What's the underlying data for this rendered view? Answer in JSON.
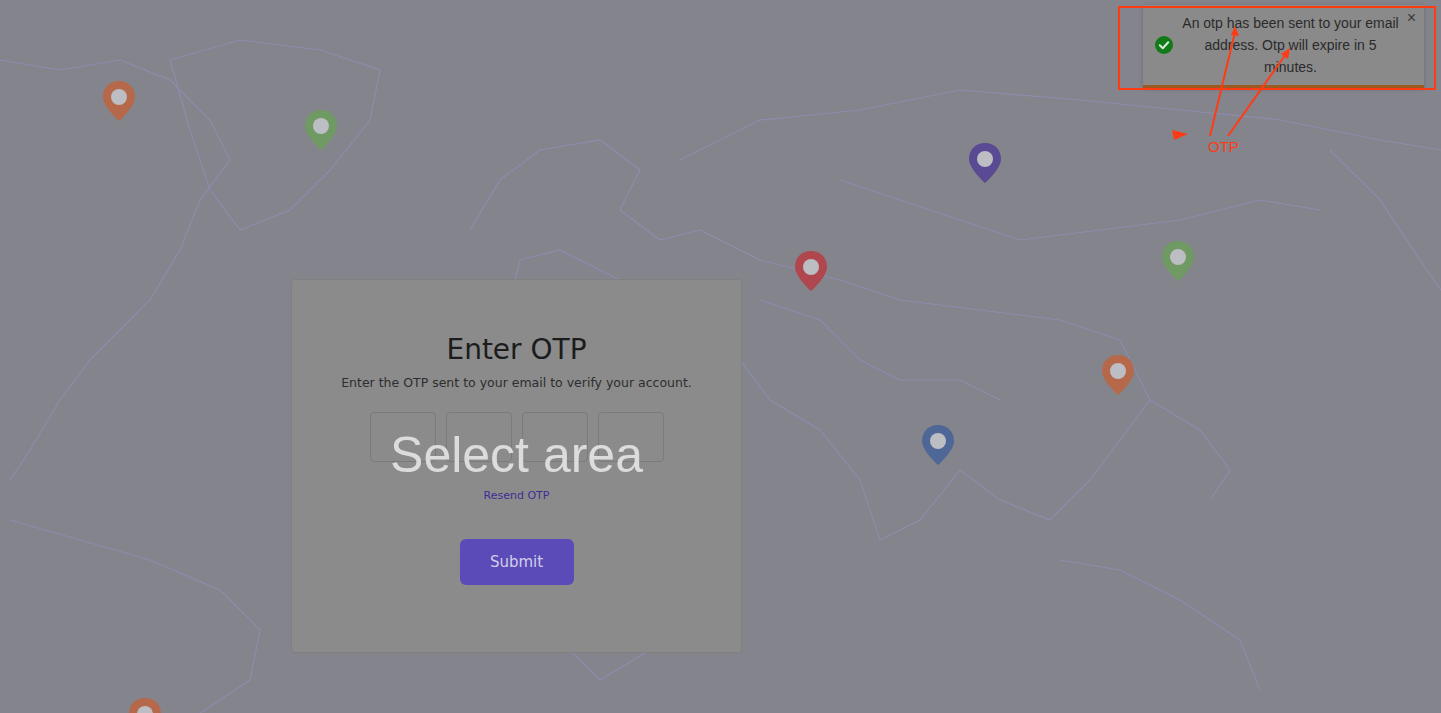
{
  "overlay": {
    "label": "Select area"
  },
  "toast": {
    "message": "An otp has been sent to your email address. Otp will expire in 5 minutes.",
    "close": "×"
  },
  "annotation": {
    "label": "OTP"
  },
  "card": {
    "title": "Enter OTP",
    "subtitle": "Enter the OTP sent to your email to verify your account.",
    "otp_fields": [
      {
        "value": ""
      },
      {
        "value": ""
      },
      {
        "value": ""
      },
      {
        "value": ""
      }
    ],
    "resend": "Resend OTP",
    "submit": "Submit"
  },
  "map": {
    "pins": [
      {
        "color": "#b5694a"
      },
      {
        "color": "#6f9a63"
      },
      {
        "color": "#5a4a94"
      },
      {
        "color": "#b0474f"
      },
      {
        "color": "#6f9a63"
      },
      {
        "color": "#b5694a"
      },
      {
        "color": "#4f6796"
      },
      {
        "color": "#b5694a"
      }
    ]
  }
}
